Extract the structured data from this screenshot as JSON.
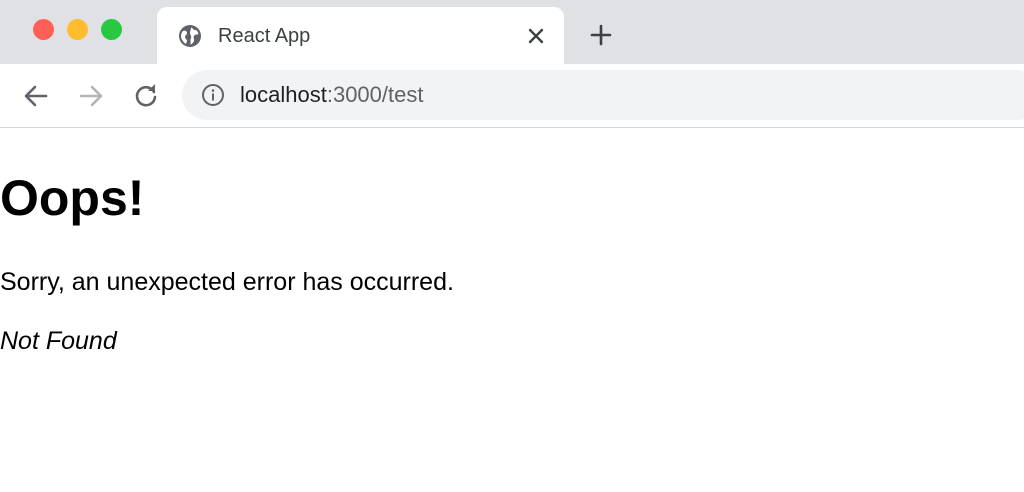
{
  "window_controls": {
    "close_color": "#fe5f57",
    "minimize_color": "#febc2e",
    "maximize_color": "#28c840"
  },
  "tab": {
    "icon": "globe-icon",
    "title": "React App",
    "close_icon": "close-icon"
  },
  "new_tab_icon": "plus-icon",
  "toolbar": {
    "back_icon": "arrow-left-icon",
    "forward_icon": "arrow-right-icon",
    "reload_icon": "reload-icon"
  },
  "address_bar": {
    "icon": "info-icon",
    "host": "localhost",
    "rest": ":3000/test"
  },
  "page": {
    "heading": "Oops!",
    "message": "Sorry, an unexpected error has occurred.",
    "status_text": "Not Found"
  }
}
